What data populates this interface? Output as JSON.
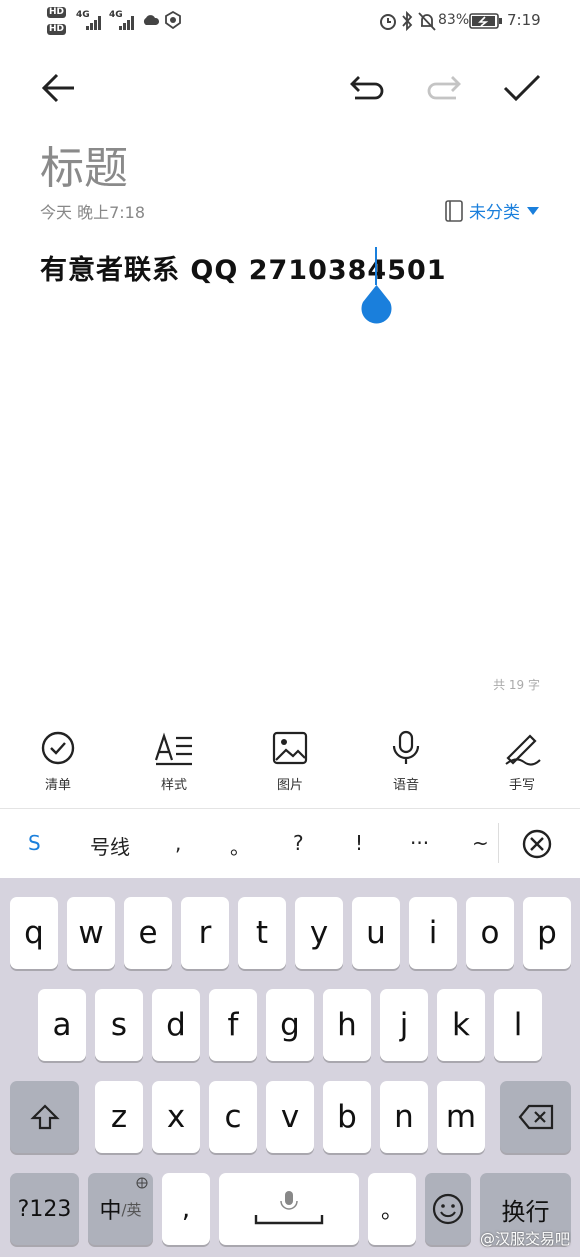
{
  "status_bar": {
    "hd_1": "HD",
    "hd_2": "HD",
    "net_1": "4G",
    "net_2": "4G",
    "battery_percent": "83%",
    "time": "7:19"
  },
  "note": {
    "title_placeholder": "标题",
    "date": "今天 晚上7:18",
    "category": "未分类",
    "content": "有意者联系 QQ 2710384501",
    "char_count": "共 19 字"
  },
  "toolbar": [
    {
      "label": "清单",
      "icon": "checklist-icon"
    },
    {
      "label": "样式",
      "icon": "text-style-icon"
    },
    {
      "label": "图片",
      "icon": "image-icon"
    },
    {
      "label": "语音",
      "icon": "microphone-icon"
    },
    {
      "label": "手写",
      "icon": "handwriting-icon"
    }
  ],
  "suggestions": [
    "S",
    "号线",
    ",",
    "。",
    "?",
    "!",
    "···",
    "~"
  ],
  "keyboard": {
    "row1": [
      "q",
      "w",
      "e",
      "r",
      "t",
      "y",
      "u",
      "i",
      "o",
      "p"
    ],
    "row2": [
      "a",
      "s",
      "d",
      "f",
      "g",
      "h",
      "j",
      "k",
      "l"
    ],
    "row3": [
      "z",
      "x",
      "c",
      "v",
      "b",
      "n",
      "m"
    ],
    "num_key": "?123",
    "lang_main": "中",
    "lang_sub": "/英",
    "comma": ",",
    "period": "。",
    "enter": "换行"
  },
  "watermark": "@汉服交易吧",
  "colors": {
    "accent": "#1a7fdc",
    "keyboard_bg": "#d6d3de"
  }
}
